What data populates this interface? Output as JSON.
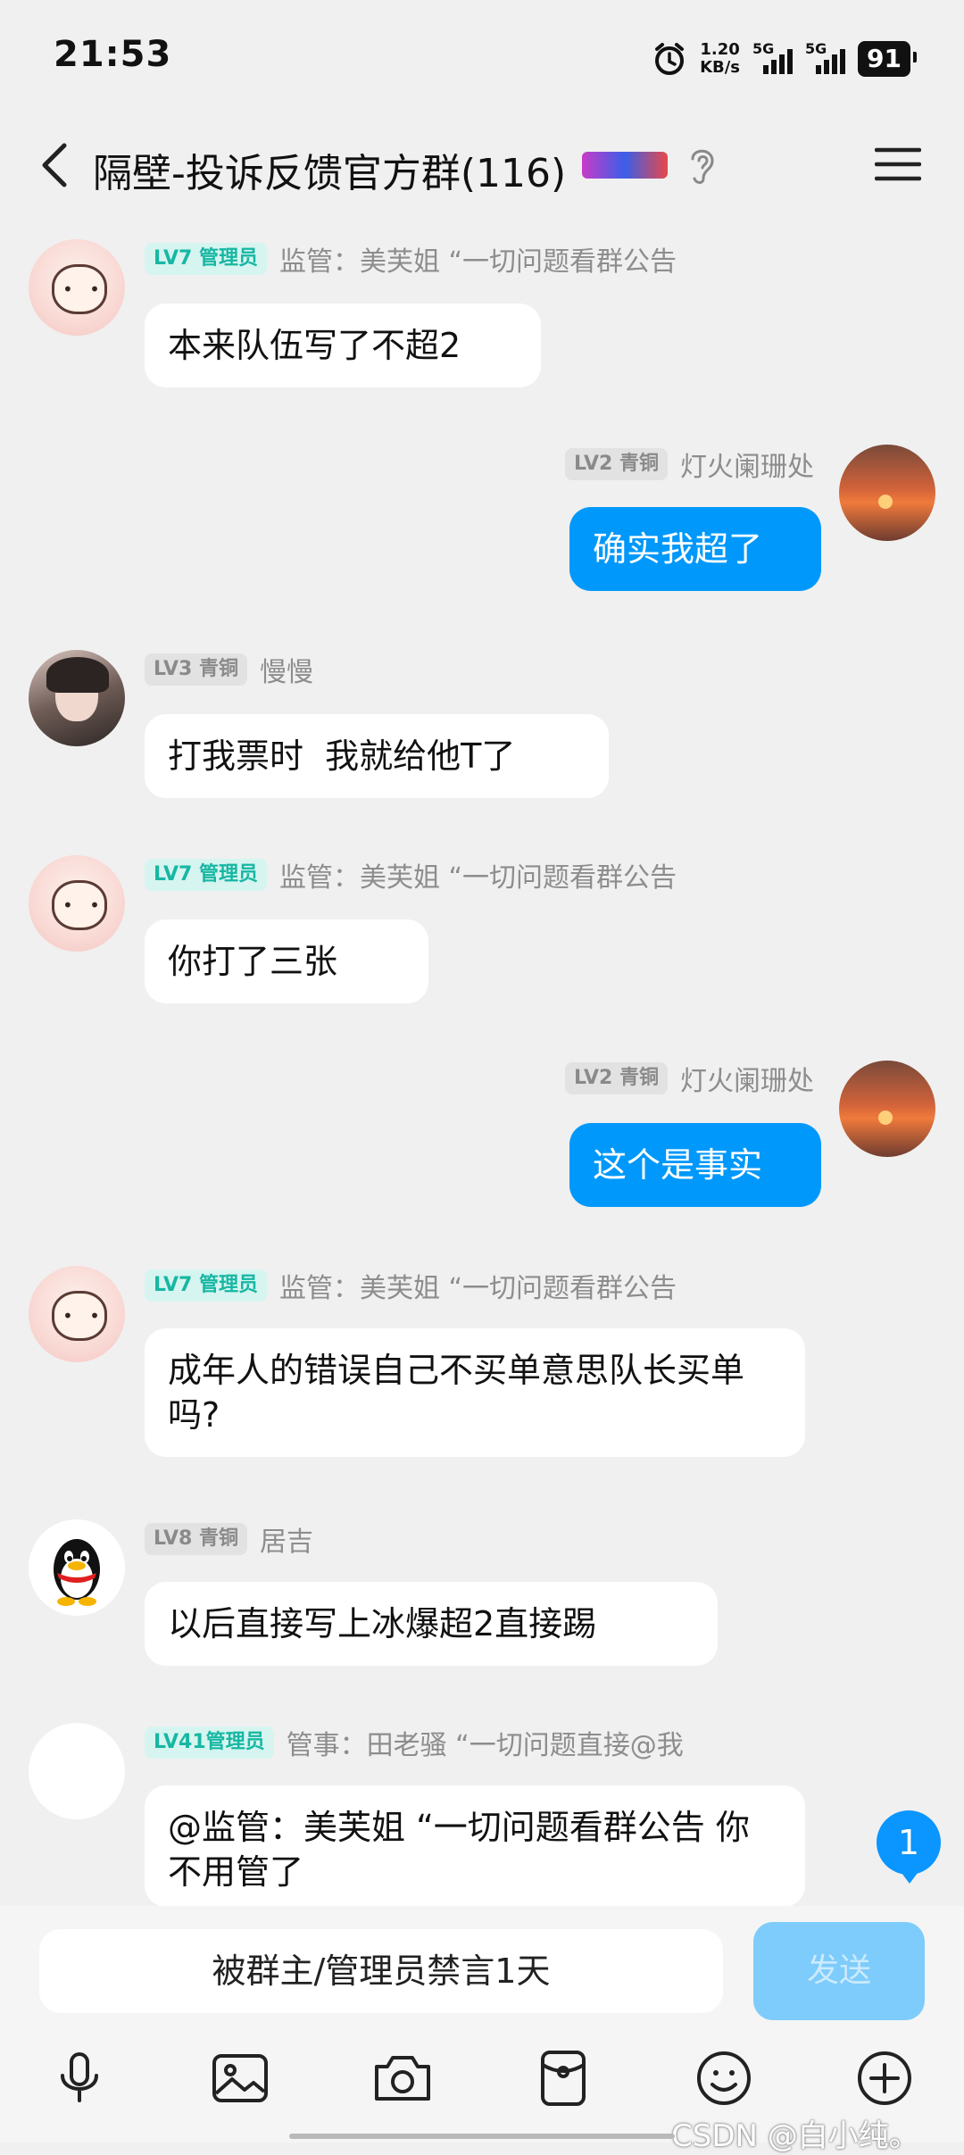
{
  "status_bar": {
    "time": "21:53",
    "net_speed_value": "1.20",
    "net_speed_unit": "KB/s",
    "sim1": "5G",
    "sim2": "5G",
    "battery": "91",
    "icons": [
      "alarm-icon",
      "signal-icon",
      "signal-icon",
      "battery-icon"
    ]
  },
  "header": {
    "title": "隔壁-投诉反馈官方群(116)",
    "icons": [
      "back-icon",
      "group-badge-icon",
      "ear-icon",
      "menu-icon"
    ]
  },
  "messages": [
    {
      "side": "left",
      "avatar": "girl-avatar",
      "level": "LV7 管理员",
      "level_style": "admin",
      "sender": "监管：美芙姐 “一切问题看群公告",
      "text": "本来队伍写了不超2"
    },
    {
      "side": "right",
      "avatar": "sunset-avatar",
      "level": "LV2 青铜",
      "level_style": "gray",
      "sender": "灯火阑珊处",
      "text": "确实我超了"
    },
    {
      "side": "left",
      "avatar": "person-avatar",
      "level": "LV3 青铜",
      "level_style": "gray",
      "sender": "慢慢",
      "text": "打我票时  我就给他T了"
    },
    {
      "side": "left",
      "avatar": "girl-avatar",
      "level": "LV7 管理员",
      "level_style": "admin",
      "sender": "监管：美芙姐 “一切问题看群公告",
      "text": "你打了三张"
    },
    {
      "side": "right",
      "avatar": "sunset-avatar",
      "level": "LV2 青铜",
      "level_style": "gray",
      "sender": "灯火阑珊处",
      "text": "这个是事实"
    },
    {
      "side": "left",
      "avatar": "girl-avatar",
      "level": "LV7 管理员",
      "level_style": "admin",
      "sender": "监管：美芙姐 “一切问题看群公告",
      "text": "成年人的错误自己不买单意思队长买单吗?"
    },
    {
      "side": "left",
      "avatar": "penguin-avatar",
      "level": "LV8 青铜",
      "level_style": "gray",
      "sender": "居吉",
      "text": "以后直接写上冰爆超2直接踢"
    },
    {
      "side": "left",
      "avatar": "blank-avatar",
      "level": "LV41管理员",
      "level_style": "admin",
      "sender": "管事：田老骚 “一切问题直接@我",
      "text": "@监管：美芙姐 “一切问题看群公告 你不用管了"
    }
  ],
  "unread_count": "1",
  "input": {
    "muted_text": "被群主/管理员禁言1天",
    "send_label": "发送"
  },
  "toolbar": [
    "mic-icon",
    "image-icon",
    "camera-icon",
    "red-packet-icon",
    "emoji-icon",
    "plus-icon"
  ],
  "watermark": "CSDN @白小纯。",
  "colors": {
    "bg": "#f0f0f0",
    "my_bubble": "#0098fa",
    "admin_badge_text": "#17b7a3",
    "send_disabled": "#7dccfb"
  }
}
